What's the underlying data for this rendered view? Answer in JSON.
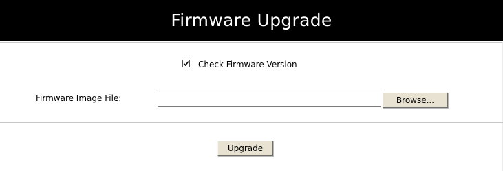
{
  "title": "Firmware Upgrade",
  "check_firmware": {
    "label": "Check Firmware Version",
    "checked": true
  },
  "firmware_file": {
    "label": "Firmware Image File:",
    "value": "",
    "placeholder": ""
  },
  "buttons": {
    "browse": "Browse...",
    "upgrade": "Upgrade"
  },
  "colors": {
    "title_bar_background": "#000000",
    "title_text": "#ffffff",
    "button_face": "#e8e2d2",
    "rule": "#c8c8c8"
  },
  "icons": {
    "checkbox": "checkmark-icon"
  }
}
